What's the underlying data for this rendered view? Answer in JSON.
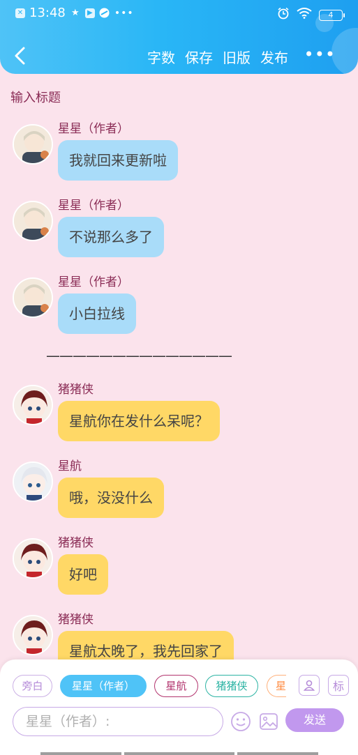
{
  "status_bar": {
    "time": "13:48",
    "battery_level": "4",
    "left_icons": [
      "close-icon",
      "star-icon",
      "play-icon",
      "app-icon",
      "more-dots-icon"
    ],
    "right_icons": [
      "alarm-icon",
      "wifi-icon",
      "battery-icon"
    ]
  },
  "header": {
    "back_icon": "back-arrow-icon",
    "actions": [
      "字数",
      "保存",
      "旧版",
      "发布"
    ],
    "more": "•••",
    "accent_colors": [
      "#4fc3f7",
      "#1e9ff0"
    ]
  },
  "title_placeholder": "输入标题",
  "messages": [
    {
      "sender": "星星（作者）",
      "text": "我就回来更新啦",
      "style": "blue",
      "avatar": "star-author-avatar"
    },
    {
      "sender": "星星（作者）",
      "text": "不说那么多了",
      "style": "blue",
      "avatar": "star-author-avatar"
    },
    {
      "sender": "星星（作者）",
      "text": "小白拉线",
      "style": "blue",
      "avatar": "star-author-avatar"
    },
    {
      "sender": "猪猪侠",
      "text": "星航你在发什么呆呢？",
      "style": "yellow",
      "avatar": "zhuzhuxia-avatar"
    },
    {
      "sender": "星航",
      "text": "哦，没没什么",
      "style": "yellow",
      "avatar": "xinghang-avatar"
    },
    {
      "sender": "猪猪侠",
      "text": "好吧",
      "style": "yellow",
      "avatar": "zhuzhuxia-avatar"
    },
    {
      "sender": "猪猪侠",
      "text": "星航太晚了，我先回家了",
      "style": "yellow",
      "avatar": "zhuzhuxia-avatar"
    }
  ],
  "divider": "——————————————",
  "roles": [
    "旁白",
    "星星（作者）",
    "星航",
    "猪猪侠",
    "星"
  ],
  "selected_role": "星星（作者）",
  "tool_buttons": {
    "role_icon": "person-icon",
    "tag_label": "标"
  },
  "composer": {
    "placeholder": "星星（作者）:",
    "send_label": "发送",
    "emoji_icon": "emoji-icon",
    "image_icon": "image-icon"
  },
  "colors": {
    "background": "#fbe3ec",
    "blue_bubble": "#a9dcf9",
    "yellow_bubble": "#ffd866",
    "name_color": "#8a2b55",
    "send_button": "#c198ee"
  }
}
